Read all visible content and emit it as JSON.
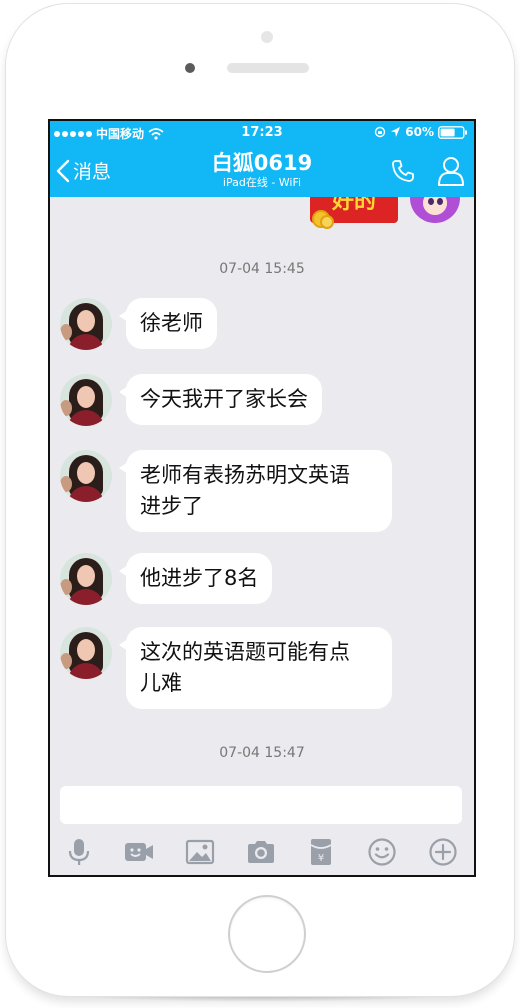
{
  "status_bar": {
    "carrier": "中国移动",
    "time": "17:23",
    "battery": "60%"
  },
  "nav": {
    "back_label": "消息",
    "title": "白狐0619",
    "subtitle": "iPad在线 - WiFi"
  },
  "previous_sticker": {
    "text": "好的"
  },
  "timestamps": [
    "07-04 15:45",
    "07-04 15:47"
  ],
  "messages": [
    {
      "sender": "白狐0619",
      "line1": "徐老师",
      "line2": ""
    },
    {
      "sender": "白狐0619",
      "line1": "今天我开了家长会",
      "line2": ""
    },
    {
      "sender": "白狐0619",
      "line1": "老师有表扬苏明文英语",
      "line2": "进步了"
    },
    {
      "sender": "白狐0619",
      "line1": "他进步了8名",
      "line2": ""
    },
    {
      "sender": "白狐0619",
      "line1": "这次的英语题可能有点",
      "line2": "儿难"
    }
  ],
  "input": {
    "value": "",
    "placeholder": ""
  },
  "toolbar_icons": [
    "microphone-icon",
    "video-call-icon",
    "image-icon",
    "camera-icon",
    "red-packet-icon",
    "emoji-icon",
    "plus-icon"
  ],
  "colors": {
    "header": "#12b7f5",
    "chat_background": "#ebebef",
    "bubble": "#ffffff",
    "icon_gray": "#9aa0aa"
  }
}
